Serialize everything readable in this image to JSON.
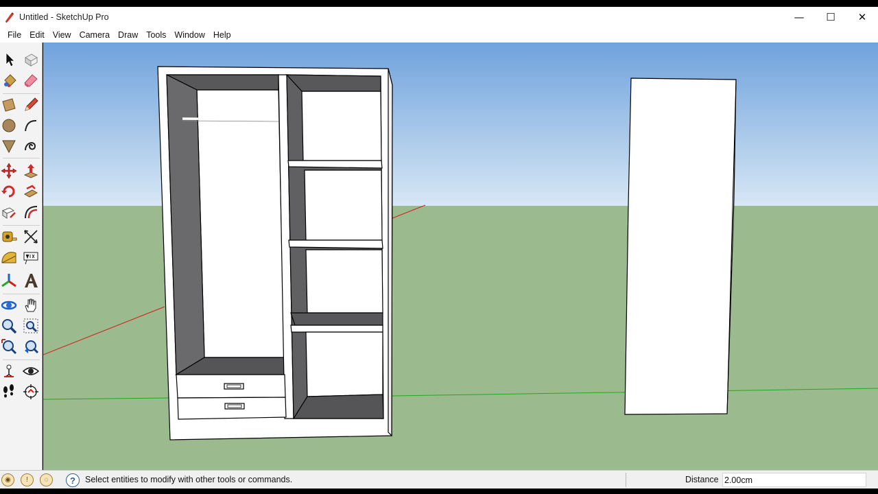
{
  "window": {
    "title": "Untitled - SketchUp Pro",
    "minimize": "—",
    "maximize": "☐",
    "close": "✕"
  },
  "menu": {
    "items": [
      "File",
      "Edit",
      "View",
      "Camera",
      "Draw",
      "Tools",
      "Window",
      "Help"
    ]
  },
  "toolbar": {
    "tools": [
      "select",
      "make-component",
      "paint-bucket",
      "eraser",
      "rectangle",
      "line",
      "circle",
      "arc",
      "polygon",
      "freehand",
      "move",
      "push-pull",
      "rotate",
      "follow-me",
      "scale",
      "offset",
      "tape-measure",
      "dimensions",
      "protractor",
      "text",
      "axes",
      "3d-text",
      "orbit",
      "pan",
      "zoom",
      "zoom-window",
      "zoom-extents",
      "previous-view",
      "position-camera",
      "look-around",
      "walk",
      "section-plane"
    ]
  },
  "status": {
    "message": "Select entities to modify with other tools or commands.",
    "measurement_label": "Distance",
    "measurement_value": "2.00cm"
  },
  "colors": {
    "sky_top": "#6fa2dd",
    "sky_bottom": "#d7e7f5",
    "ground": "#9bba8e",
    "interior_shadow": "#606062",
    "red_axis": "#d02020",
    "green_axis": "#1faa1f"
  }
}
